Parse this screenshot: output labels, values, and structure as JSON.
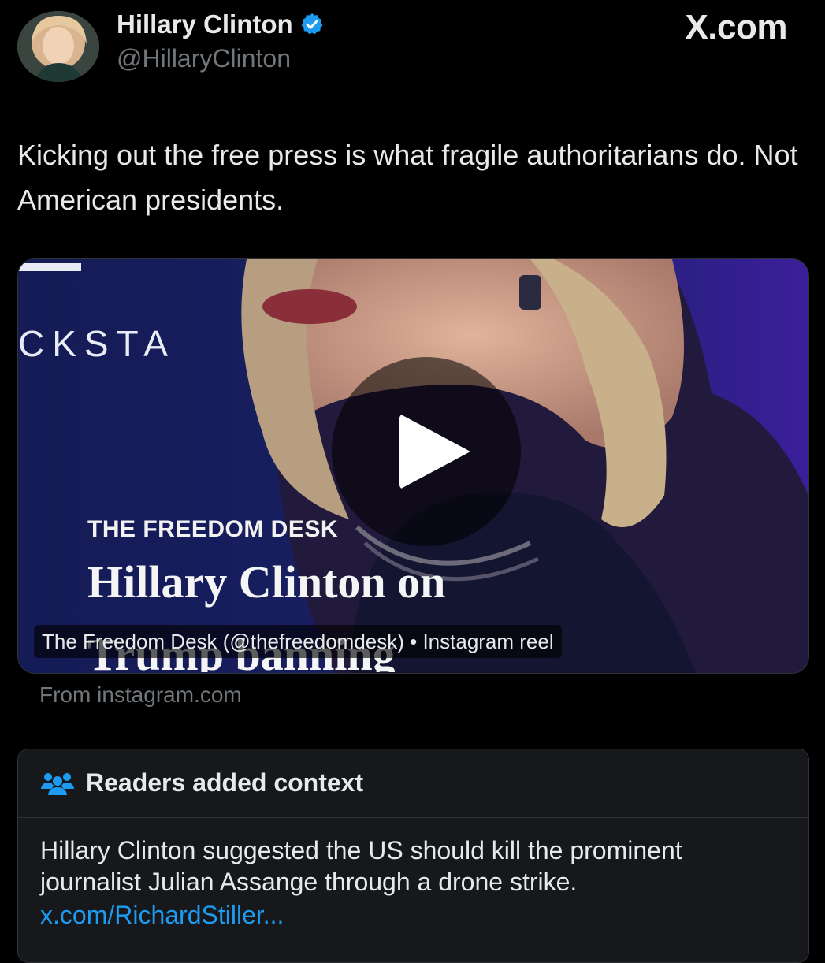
{
  "author": {
    "name": "Hillary Clinton",
    "handle": "@HillaryClinton",
    "verified": true,
    "avatar_icon": "profile-photo"
  },
  "site": {
    "label": "X.com"
  },
  "tweet": {
    "text": "Kicking out the free press is what fragile authoritarians do. Not American presidents."
  },
  "media": {
    "background_logo_text": "CKSTA",
    "overlay_kicker": "THE FREEDOM DESK",
    "overlay_title_line1": "Hillary Clinton on",
    "overlay_title_line2": "Trump banning",
    "caption": "The Freedom Desk (@thefreedomdesk) • Instagram reel",
    "play_icon": "play-icon",
    "source": "From instagram.com"
  },
  "context": {
    "icon": "people-icon",
    "title": "Readers added context",
    "body": "Hillary Clinton suggested the US should kill the prominent journalist Julian Assange through a drone strike.",
    "link": "x.com/RichardStiller..."
  },
  "colors": {
    "background": "#000000",
    "text_primary": "#e7e9ea",
    "text_secondary": "#71767b",
    "link": "#1d9bf0",
    "verified": "#1d9bf0",
    "border": "#2f3336",
    "context_bg": "#16181c"
  }
}
